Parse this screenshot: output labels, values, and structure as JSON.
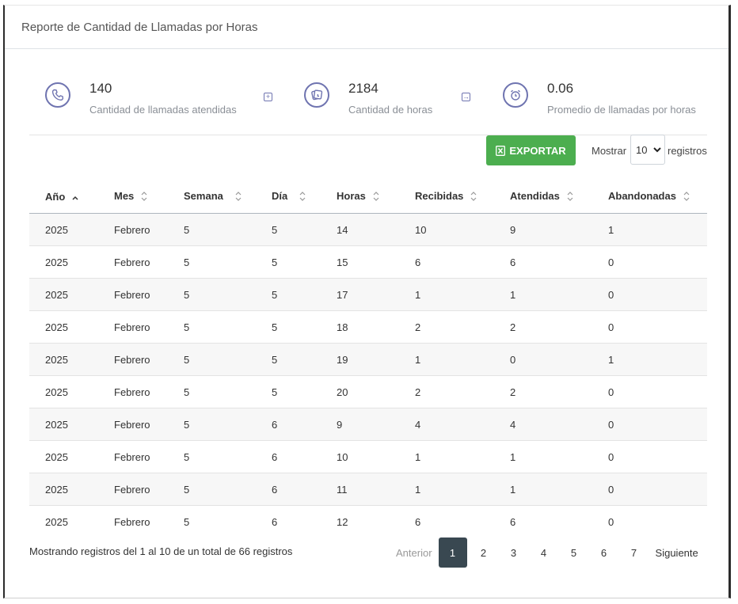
{
  "header": {
    "title": "Reporte de Cantidad de Llamadas por Horas"
  },
  "stats": [
    {
      "value": "140",
      "label": "Cantidad de llamadas atendidas",
      "icon": "phone-icon"
    },
    {
      "value": "2184",
      "label": "Cantidad de horas",
      "icon": "hours-icon"
    },
    {
      "value": "0.06",
      "label": "Promedio de llamadas por horas",
      "icon": "alarm-clock-icon"
    }
  ],
  "separators": [
    {
      "icon": "plus-square-icon",
      "symbol": "+"
    },
    {
      "icon": "arrow-right-square-icon",
      "symbol": "→"
    }
  ],
  "toolbar": {
    "export_label": "EXPORTAR",
    "show_label": "Mostrar",
    "page_size": "10",
    "records_label": "registros"
  },
  "colors": {
    "accent": "#6f74b0",
    "export": "#4cae4f",
    "pager_active": "#394851"
  },
  "table": {
    "columns": [
      "Año",
      "Mes",
      "Semana",
      "Día",
      "Horas",
      "Recibidas",
      "Atendidas",
      "Abandonadas"
    ],
    "rows": [
      [
        "2025",
        "Febrero",
        "5",
        "5",
        "14",
        "10",
        "9",
        "1"
      ],
      [
        "2025",
        "Febrero",
        "5",
        "5",
        "15",
        "6",
        "6",
        "0"
      ],
      [
        "2025",
        "Febrero",
        "5",
        "5",
        "17",
        "1",
        "1",
        "0"
      ],
      [
        "2025",
        "Febrero",
        "5",
        "5",
        "18",
        "2",
        "2",
        "0"
      ],
      [
        "2025",
        "Febrero",
        "5",
        "5",
        "19",
        "1",
        "0",
        "1"
      ],
      [
        "2025",
        "Febrero",
        "5",
        "5",
        "20",
        "2",
        "2",
        "0"
      ],
      [
        "2025",
        "Febrero",
        "5",
        "6",
        "9",
        "4",
        "4",
        "0"
      ],
      [
        "2025",
        "Febrero",
        "5",
        "6",
        "10",
        "1",
        "1",
        "0"
      ],
      [
        "2025",
        "Febrero",
        "5",
        "6",
        "11",
        "1",
        "1",
        "0"
      ],
      [
        "2025",
        "Febrero",
        "5",
        "6",
        "12",
        "6",
        "6",
        "0"
      ]
    ]
  },
  "footer": {
    "info": "Mostrando registros del 1 al 10 de un total de 66 registros",
    "prev": "Anterior",
    "next": "Siguiente",
    "pages": [
      "1",
      "2",
      "3",
      "4",
      "5",
      "6",
      "7"
    ]
  }
}
